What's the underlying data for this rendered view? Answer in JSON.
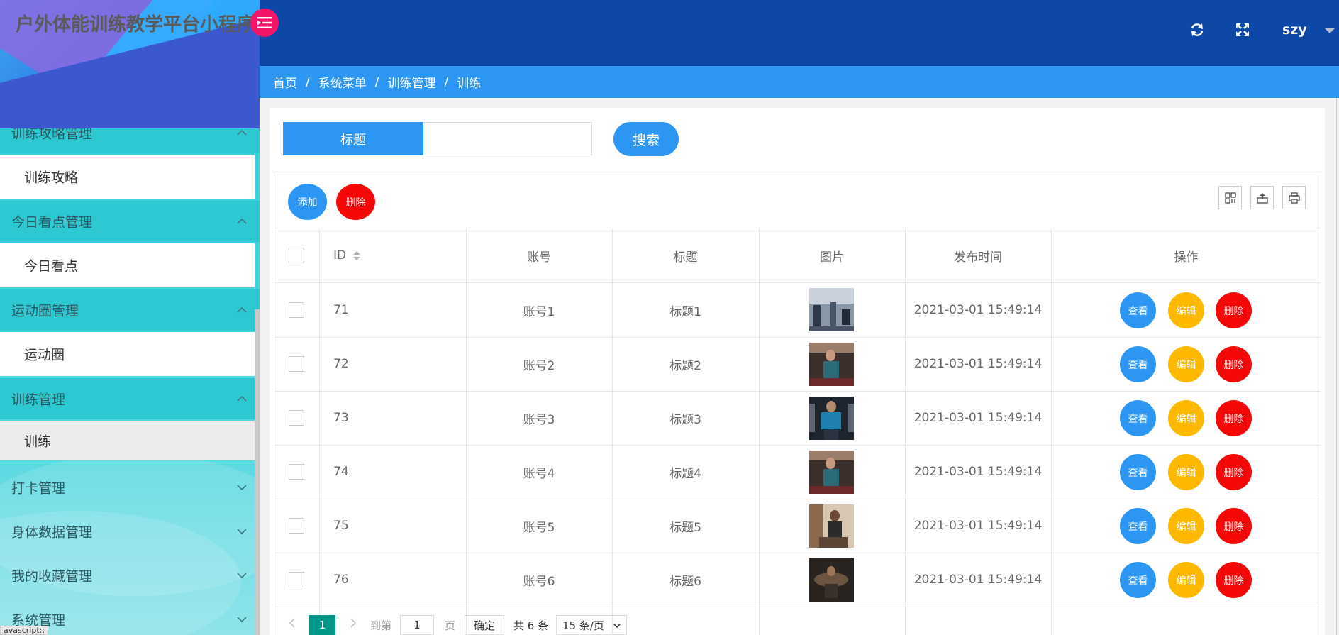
{
  "app": {
    "title": "户外体能训练教学平台小程序"
  },
  "header": {
    "refresh_icon": "refresh-icon",
    "fullscreen_icon": "fullscreen-icon",
    "user": "szy"
  },
  "sidebar": {
    "groups": [
      {
        "label": "训练攻略管理",
        "open": true,
        "sub": [
          "训练攻略"
        ]
      },
      {
        "label": "今日看点管理",
        "open": true,
        "sub": [
          "今日看点"
        ]
      },
      {
        "label": "运动圈管理",
        "open": true,
        "sub": [
          "运动圈"
        ]
      },
      {
        "label": "训练管理",
        "open": true,
        "sub": [
          "训练"
        ]
      },
      {
        "label": "打卡管理",
        "open": false,
        "sub": []
      },
      {
        "label": "身体数据管理",
        "open": false,
        "sub": []
      },
      {
        "label": "我的收藏管理",
        "open": false,
        "sub": []
      },
      {
        "label": "系统管理",
        "open": false,
        "sub": []
      }
    ],
    "active_sub": "训练",
    "status_url": "avascript:;"
  },
  "breadcrumb": [
    "首页",
    "系统菜单",
    "训练管理",
    "训练"
  ],
  "search": {
    "label": "标题",
    "value": "",
    "placeholder": "",
    "button": "搜索"
  },
  "toolbar": {
    "add": "添加",
    "delete": "删除"
  },
  "table": {
    "columns": [
      "ID",
      "账号",
      "标题",
      "图片",
      "发布时间",
      "操作"
    ],
    "rows": [
      {
        "id": "71",
        "account": "账号1",
        "title": "标题1",
        "time": "2021-03-01 15:49:14"
      },
      {
        "id": "72",
        "account": "账号2",
        "title": "标题2",
        "time": "2021-03-01 15:49:14"
      },
      {
        "id": "73",
        "account": "账号3",
        "title": "标题3",
        "time": "2021-03-01 15:49:14"
      },
      {
        "id": "74",
        "account": "账号4",
        "title": "标题4",
        "time": "2021-03-01 15:49:14"
      },
      {
        "id": "75",
        "account": "账号5",
        "title": "标题5",
        "time": "2021-03-01 15:49:14"
      },
      {
        "id": "76",
        "account": "账号6",
        "title": "标题6",
        "time": "2021-03-01 15:49:14"
      }
    ],
    "actions": {
      "view": "查看",
      "edit": "编辑",
      "delete": "删除"
    }
  },
  "pager": {
    "current": "1",
    "goto_prefix": "到第",
    "goto_value": "1",
    "goto_suffix": "页",
    "confirm": "确定",
    "total": "共 6 条",
    "per_page": "15 条/页"
  },
  "colors": {
    "header": "#0d47a8",
    "breadcrumb": "#2c96f2",
    "primary": "#2c96f2",
    "danger": "#f40808",
    "warning": "#ffb800",
    "sidebar": "#2ecfd8",
    "toggle": "#f4156a"
  }
}
